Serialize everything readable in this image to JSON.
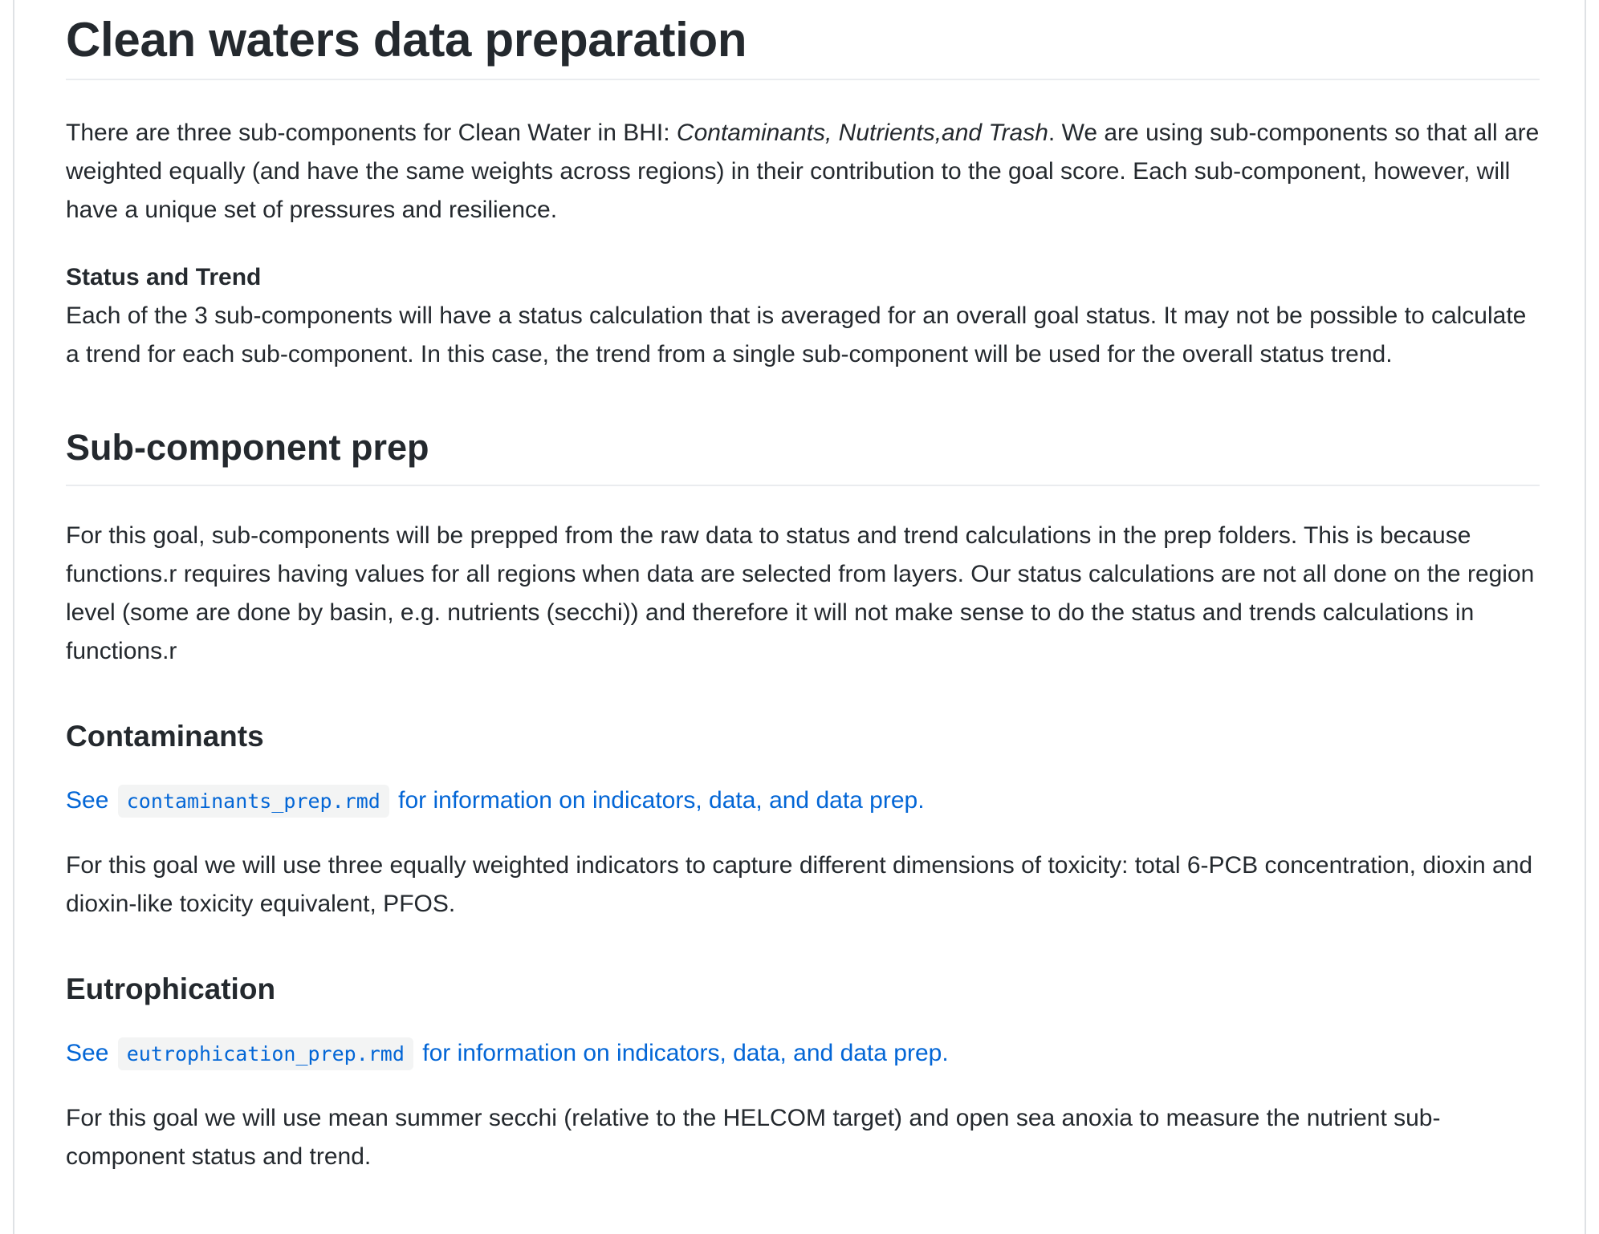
{
  "title": "Clean waters data preparation",
  "intro": {
    "before": "There are three sub-components for Clean Water in BHI: ",
    "emphasis": "Contaminants, Nutrients,and Trash",
    "after": ". We are using sub-components so that all are weighted equally (and have the same weights across regions) in their contribution to the goal score. Each sub-component, however, will have a unique set of pressures and resilience."
  },
  "status_trend": {
    "heading": "Status and Trend",
    "text": "Each of the 3 sub-components will have a status calculation that is averaged for an overall goal status. It may not be possible to calculate a trend for each sub-component. In this case, the trend from a single sub-component will be used for the overall status trend."
  },
  "subcomponent_prep": {
    "heading": "Sub-component prep",
    "text": "For this goal, sub-components will be prepped from the raw data to status and trend calculations in the prep folders. This is because functions.r requires having values for all regions when data are selected from layers. Our status calculations are not all done on the region level (some are done by basin, e.g. nutrients (secchi)) and therefore it will not make sense to do the status and trends calculations in functions.r"
  },
  "contaminants": {
    "heading": "Contaminants",
    "link_before": "See",
    "link_code": "contaminants_prep.rmd",
    "link_after": "for information on indicators, data, and data prep.",
    "text": "For this goal we will use three equally weighted indicators to capture different dimensions of toxicity: total 6-PCB concentration, dioxin and dioxin-like toxicity equivalent, PFOS."
  },
  "eutrophication": {
    "heading": "Eutrophication",
    "link_before": "See",
    "link_code": "eutrophication_prep.rmd",
    "link_after": "for information on indicators, data, and data prep.",
    "text": "For this goal we will use mean summer secchi (relative to the HELCOM target) and open sea anoxia to measure the nutrient sub-component status and trend."
  },
  "colors": {
    "text": "#24292e",
    "link": "#0366d6",
    "code_bg": "#f3f4f4",
    "rule": "#eaecef"
  }
}
